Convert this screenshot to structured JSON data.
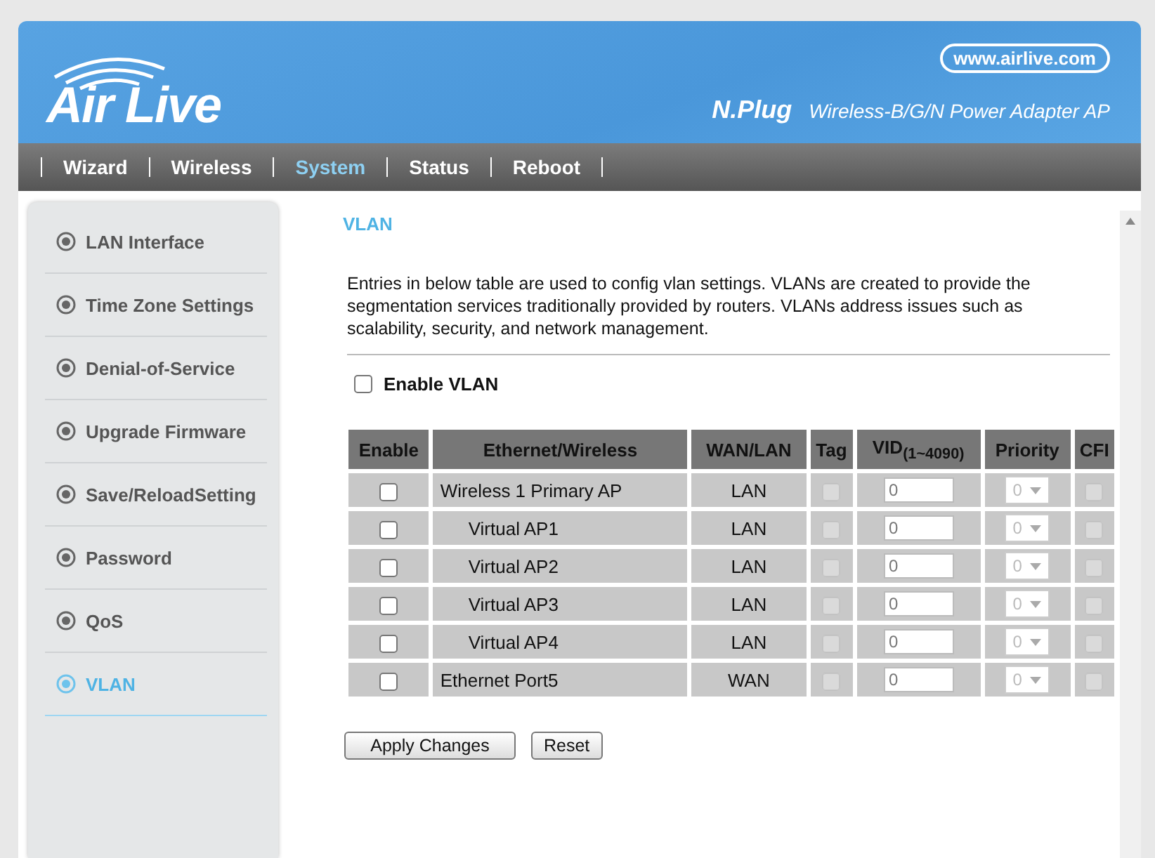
{
  "header": {
    "logo": "Air Live",
    "url": "www.airlive.com",
    "product": "N.Plug",
    "tagline": "Wireless-B/G/N Power Adapter AP"
  },
  "nav": [
    {
      "label": "Wizard",
      "selected": false
    },
    {
      "label": "Wireless",
      "selected": false
    },
    {
      "label": "System",
      "selected": true
    },
    {
      "label": "Status",
      "selected": false
    },
    {
      "label": "Reboot",
      "selected": false
    }
  ],
  "sidebar": [
    {
      "label": "LAN Interface",
      "selected": false
    },
    {
      "label": "Time Zone Settings",
      "selected": false
    },
    {
      "label": "Denial-of-Service",
      "selected": false
    },
    {
      "label": "Upgrade Firmware",
      "selected": false
    },
    {
      "label": "Save/ReloadSetting",
      "selected": false
    },
    {
      "label": "Password",
      "selected": false
    },
    {
      "label": "QoS",
      "selected": false
    },
    {
      "label": "VLAN",
      "selected": true
    }
  ],
  "title": "VLAN",
  "description": "Entries in below table are used to config vlan settings. VLANs are created to provide the segmentation services traditionally provided by routers. VLANs address issues such as scalability, security, and network management.",
  "enable_vlan": {
    "label": "Enable VLAN",
    "checked": false
  },
  "table": {
    "columns": [
      "Enable",
      "Ethernet/Wireless",
      "WAN/LAN",
      "Tag",
      "VID$_{(1~4090)}$",
      "Priority",
      "CFI"
    ],
    "rows": [
      {
        "enabled": false,
        "name": "Wireless 1 Primary AP",
        "wan_lan": "LAN",
        "tag": false,
        "vid": "0",
        "priority": "0",
        "cfi": false,
        "disabled": true,
        "children": [
          {
            "enabled": false,
            "name": "Virtual AP1",
            "wan_lan": "LAN",
            "tag": false,
            "vid": "0",
            "priority": "0",
            "cfi": false,
            "disabled": true
          },
          {
            "enabled": false,
            "name": "Virtual AP2",
            "wan_lan": "LAN",
            "tag": false,
            "vid": "0",
            "priority": "0",
            "cfi": false,
            "disabled": true
          },
          {
            "enabled": false,
            "name": "Virtual AP3",
            "wan_lan": "LAN",
            "tag": false,
            "vid": "0",
            "priority": "0",
            "cfi": false,
            "disabled": true
          },
          {
            "enabled": false,
            "name": "Virtual AP4",
            "wan_lan": "LAN",
            "tag": false,
            "vid": "0",
            "priority": "0",
            "cfi": false,
            "disabled": true
          }
        ]
      },
      {
        "enabled": false,
        "name": "Ethernet Port5",
        "wan_lan": "WAN",
        "tag": false,
        "vid": "0",
        "priority": "0",
        "cfi": false,
        "disabled": true
      }
    ]
  },
  "buttons": [
    "Apply Changes",
    "Reset"
  ]
}
